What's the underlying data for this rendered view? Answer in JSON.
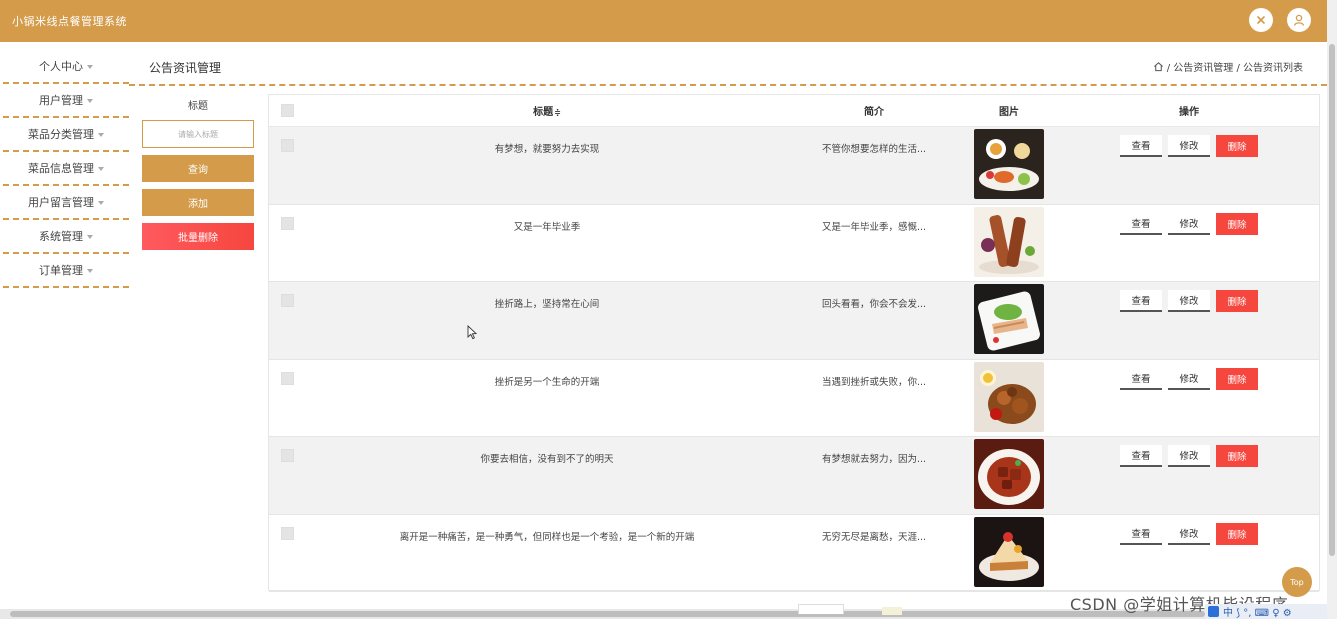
{
  "app": {
    "title": "小锅米线点餐管理系统",
    "accent_color": "#d39b4a",
    "danger_color": "#f6473f",
    "header_icons": [
      "close-circle-icon",
      "user-icon"
    ]
  },
  "sidebar": {
    "items": [
      {
        "label": "个人中心"
      },
      {
        "label": "用户管理"
      },
      {
        "label": "菜品分类管理"
      },
      {
        "label": "菜品信息管理"
      },
      {
        "label": "用户留言管理"
      },
      {
        "label": "系统管理"
      },
      {
        "label": "订单管理"
      }
    ]
  },
  "page": {
    "title": "公告资讯管理",
    "breadcrumb": "/ 公告资讯管理 / 公告资讯列表"
  },
  "filter": {
    "label": "标题",
    "placeholder": "请输入标题",
    "query_button": "查询",
    "add_button": "添加",
    "batch_delete_button": "批量删除"
  },
  "table": {
    "columns": {
      "title": "标题",
      "sort_mark": "≑",
      "intro": "简介",
      "image": "图片",
      "ops": "操作"
    },
    "actions": {
      "view": "查看",
      "edit": "修改",
      "delete": "删除"
    },
    "rows": [
      {
        "title": "有梦想，就要努力去实现",
        "intro": "不管你想要怎样的生活...",
        "image": "dessert-plate"
      },
      {
        "title": "又是一年毕业季",
        "intro": "又是一年毕业季，感慨...",
        "image": "skewers"
      },
      {
        "title": "挫折路上，坚持常在心间",
        "intro": "回头看看，你会不会发...",
        "image": "sliced-meat-plate"
      },
      {
        "title": "挫折是另一个生命的开端",
        "intro": "当遇到挫折或失败，你...",
        "image": "fried-chicken"
      },
      {
        "title": "你要去相信，没有到不了的明天",
        "intro": "有梦想就去努力，因为...",
        "image": "braised-pork"
      },
      {
        "title": "离开是一种痛苦，是一种勇气，但同样也是一个考验，是一个新的开端",
        "intro": "无穷无尽是离愁，天涯...",
        "image": "cake-slice"
      }
    ]
  },
  "overlay": {
    "top_button": "Top",
    "watermark": "CSDN @学姐计算机毕设程序",
    "ime_text": "中 ⟆ °, ⌨ ♀ ⚙"
  }
}
